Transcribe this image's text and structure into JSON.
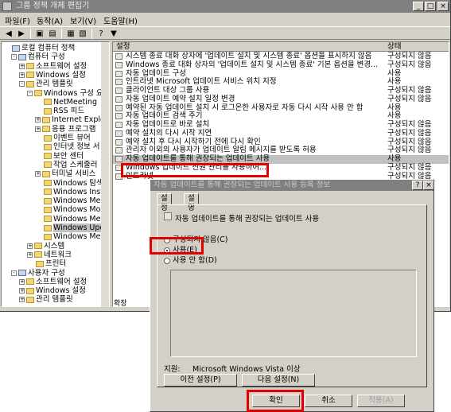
{
  "window": {
    "title": "그룹 정책 개체 편집기",
    "controls": [
      "_",
      "□",
      "×"
    ]
  },
  "menu": [
    "파일(F)",
    "동작(A)",
    "보기(V)",
    "도움말(H)"
  ],
  "toolbar_icons": [
    "back-icon",
    "forward-icon",
    "up-icon",
    "show-tree-icon",
    "properties-icon",
    "refresh-icon",
    "export-icon",
    "help-icon",
    "filter-icon"
  ],
  "tree": [
    {
      "label": "로컬 컴퓨터 정책",
      "indent": 0,
      "pm": "",
      "icon": "computer-icon"
    },
    {
      "label": "컴퓨터 구성",
      "indent": 1,
      "pm": "-",
      "icon": "computer-icon"
    },
    {
      "label": "소프트웨어 설정",
      "indent": 2,
      "pm": "+",
      "icon": "folder"
    },
    {
      "label": "Windows 설정",
      "indent": 2,
      "pm": "+",
      "icon": "folder"
    },
    {
      "label": "관리 템플릿",
      "indent": 2,
      "pm": "-",
      "icon": "folder"
    },
    {
      "label": "Windows 구성 요",
      "indent": 3,
      "pm": "-",
      "icon": "folder"
    },
    {
      "label": "NetMeeting",
      "indent": 4,
      "pm": "",
      "icon": "folder"
    },
    {
      "label": "RSS 피드",
      "indent": 4,
      "pm": "",
      "icon": "folder"
    },
    {
      "label": "Internet Explo",
      "indent": 4,
      "pm": "+",
      "icon": "folder"
    },
    {
      "label": "응용 프로그램",
      "indent": 4,
      "pm": "+",
      "icon": "folder"
    },
    {
      "label": "이벤트 뷰어",
      "indent": 4,
      "pm": "",
      "icon": "folder"
    },
    {
      "label": "인터넷 정보 서",
      "indent": 4,
      "pm": "",
      "icon": "folder"
    },
    {
      "label": "보안 센터",
      "indent": 4,
      "pm": "",
      "icon": "folder"
    },
    {
      "label": "작업 스케줄러",
      "indent": 4,
      "pm": "",
      "icon": "folder"
    },
    {
      "label": "터미널 서비스",
      "indent": 4,
      "pm": "+",
      "icon": "folder"
    },
    {
      "label": "Windows 탐색",
      "indent": 4,
      "pm": "",
      "icon": "folder"
    },
    {
      "label": "Windows Inst",
      "indent": 4,
      "pm": "",
      "icon": "folder"
    },
    {
      "label": "Windows Me",
      "indent": 4,
      "pm": "",
      "icon": "folder"
    },
    {
      "label": "Windows Mo",
      "indent": 4,
      "pm": "",
      "icon": "folder"
    },
    {
      "label": "Windows Me",
      "indent": 4,
      "pm": "",
      "icon": "folder"
    },
    {
      "label": "Windows Upc",
      "indent": 4,
      "pm": "",
      "icon": "folder",
      "selected": true
    },
    {
      "label": "Windows Me",
      "indent": 4,
      "pm": "",
      "icon": "folder"
    },
    {
      "label": "시스템",
      "indent": 3,
      "pm": "+",
      "icon": "folder"
    },
    {
      "label": "네트워크",
      "indent": 3,
      "pm": "+",
      "icon": "folder"
    },
    {
      "label": "프린터",
      "indent": 3,
      "pm": "",
      "icon": "folder"
    },
    {
      "label": "사용자 구성",
      "indent": 1,
      "pm": "-",
      "icon": "user-icon"
    },
    {
      "label": "소프트웨어 설정",
      "indent": 2,
      "pm": "+",
      "icon": "folder"
    },
    {
      "label": "Windows 설정",
      "indent": 2,
      "pm": "+",
      "icon": "folder"
    },
    {
      "label": "관리 템플릿",
      "indent": 2,
      "pm": "+",
      "icon": "folder"
    }
  ],
  "list": {
    "col_setting": "설정",
    "col_state": "상태",
    "rows": [
      {
        "name": "시스템 종료 대화 상자에 '업데이트 설치 및 시스템 종료' 옵션을 표시하지 않음",
        "state": "구성되지 않음"
      },
      {
        "name": "Windows 종료 대화 상자의 '업데이트 설치 및 시스템 종료' 기본 옵션을 변경...",
        "state": "구성되지 않음"
      },
      {
        "name": "자동 업데이트 구성",
        "state": "사용"
      },
      {
        "name": "인트라넷 Microsoft 업데이트 서비스 위치 지정",
        "state": "사용"
      },
      {
        "name": "클라이언트 대상 그룹 사용",
        "state": "구성되지 않음"
      },
      {
        "name": "자동 업데이트 예약 설치 일정 변경",
        "state": "구성되지 않음"
      },
      {
        "name": "예약된 자동 업데이트 설치 시 로그온한 사용자로 자동 다시 시작 사용 안 함",
        "state": "사용"
      },
      {
        "name": "자동 업데이트 검색 주기",
        "state": "사용"
      },
      {
        "name": "자동 업데이트로 바로 설치",
        "state": "구성되지 않음"
      },
      {
        "name": "예약 설치의 다시 시작 지연",
        "state": "구성되지 않음"
      },
      {
        "name": "예약 설치 후 다시 시작하기 전에 다시 확인",
        "state": "구성되지 않음"
      },
      {
        "name": "관리자 이외의 사용자가 업데이트 알림 메시지를 받도록 허용",
        "state": "구성되지 않음"
      },
      {
        "name": "자동 업데이트를 통해 권장되는 업데이트 사용",
        "state": "사용",
        "selected": true
      },
      {
        "name": "Windows 업데이트 전원 관리를 사용하여...",
        "state": "구성되지 않음"
      },
      {
        "name": "인트라넷",
        "state": "구성되지 않음"
      }
    ]
  },
  "bottom_tabs": "확장",
  "dialog": {
    "title": "자동 업데이트를 통해 권장되는 업데이트 사용 등록 정보",
    "help_btn": "?",
    "close_btn": "×",
    "tabs": [
      "설정",
      "설명"
    ],
    "policy_name": "자동 업데이트를 통해 권장되는 업데이트 사용",
    "radios": [
      {
        "label": "구성되지 않음(C)",
        "checked": false
      },
      {
        "label": "사용(E)",
        "checked": true
      },
      {
        "label": "사용 안 함(D)",
        "checked": false
      }
    ],
    "support_label": "지원:",
    "support_value": "Microsoft Windows Vista 이상",
    "prev_button": "이전 설정(P)",
    "next_button": "다음 설정(N)",
    "ok_button": "확인",
    "cancel_button": "취소",
    "apply_button": "적용(A)"
  }
}
